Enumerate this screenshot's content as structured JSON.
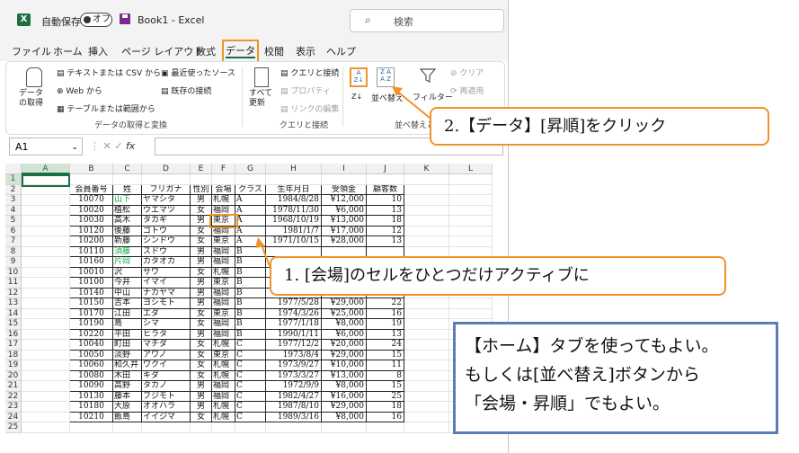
{
  "titlebar": {
    "logo_letter": "X",
    "autosave_label": "自動保存",
    "toggle_label": "オフ",
    "book_title": "Book1 - Excel",
    "search_placeholder": "検索",
    "search_icon": "search-icon"
  },
  "tabs": [
    {
      "label": "ファイル",
      "selected": false
    },
    {
      "label": "ホーム",
      "selected": false
    },
    {
      "label": "挿入",
      "selected": false
    },
    {
      "label": "ページ レイアウト",
      "selected": false
    },
    {
      "label": "数式",
      "selected": false
    },
    {
      "label": "データ",
      "selected": true
    },
    {
      "label": "校閲",
      "selected": false
    },
    {
      "label": "表示",
      "selected": false
    },
    {
      "label": "ヘルプ",
      "selected": false
    }
  ],
  "ribbon": {
    "get_data_label": "データの取得",
    "text_csv": "テキストまたは CSV から",
    "web": "Web から",
    "table_range": "テーブルまたは範囲から",
    "recent_sources": "最近使ったソース",
    "existing_conn": "既存の接続",
    "group1": "データの取得と変換",
    "refresh_all": "すべて更新",
    "queries_conn": "クエリと接続",
    "properties": "プロパティ",
    "edit_links": "リンクの編集",
    "group2": "クエリと接続",
    "sort_asc_icon": "sort-ascending-icon",
    "sort_desc_icon": "sort-descending-icon",
    "sort": "並べ替え",
    "filter": "フィルター",
    "clear": "クリア",
    "reapply": "再適用",
    "group3": "並べ替えと"
  },
  "formula_bar": {
    "name_box": "A1",
    "fx": "fx"
  },
  "grid": {
    "columns": [
      "A",
      "B",
      "C",
      "D",
      "E",
      "F",
      "G",
      "H",
      "I",
      "J",
      "K",
      "L"
    ],
    "headers": [
      "会員番号",
      "姓",
      "フリガナ",
      "性別",
      "会場",
      "クラス",
      "生年月日",
      "受領金",
      "顧客数"
    ],
    "rows": [
      [
        "10070",
        "山下",
        "ヤマシタ",
        "男",
        "札幌",
        "A",
        "1984/8/28",
        "¥12,000",
        "10"
      ],
      [
        "10020",
        "植松",
        "ウエマツ",
        "女",
        "福岡",
        "A",
        "1978/11/30",
        "¥6,000",
        "13"
      ],
      [
        "10030",
        "高木",
        "タカギ",
        "男",
        "東京",
        "A",
        "1968/10/19",
        "¥13,000",
        "18"
      ],
      [
        "10120",
        "後藤",
        "ゴトウ",
        "女",
        "福岡",
        "A",
        "1981/1/7",
        "¥17,000",
        "12"
      ],
      [
        "10200",
        "新藤",
        "シンドウ",
        "女",
        "東京",
        "A",
        "1971/10/15",
        "¥28,000",
        "13"
      ],
      [
        "10110",
        "須藤",
        "スドウ",
        "男",
        "福岡",
        "B",
        "",
        "",
        ""
      ],
      [
        "10160",
        "片岡",
        "カタオカ",
        "男",
        "福岡",
        "B",
        "",
        "",
        ""
      ],
      [
        "10010",
        "沢",
        "サワ",
        "女",
        "札幌",
        "B",
        "",
        "",
        ""
      ],
      [
        "10100",
        "今井",
        "イマイ",
        "男",
        "東京",
        "B",
        "",
        "",
        ""
      ],
      [
        "10140",
        "中山",
        "ナカヤマ",
        "男",
        "福岡",
        "B",
        "1990/4/20",
        "¥17,000",
        "11"
      ],
      [
        "10150",
        "吉本",
        "ヨシモト",
        "男",
        "福岡",
        "B",
        "1977/5/28",
        "¥29,000",
        "22"
      ],
      [
        "10170",
        "江田",
        "エダ",
        "女",
        "東京",
        "B",
        "1974/3/26",
        "¥25,000",
        "16"
      ],
      [
        "10190",
        "島",
        "シマ",
        "女",
        "福岡",
        "B",
        "1977/1/18",
        "¥8,000",
        "19"
      ],
      [
        "10220",
        "平田",
        "ヒラタ",
        "男",
        "福岡",
        "B",
        "1990/1/11",
        "¥6,000",
        "13"
      ],
      [
        "10040",
        "町田",
        "マチダ",
        "女",
        "札幌",
        "C",
        "1977/12/2",
        "¥20,000",
        "24"
      ],
      [
        "10050",
        "淡野",
        "アワノ",
        "女",
        "東京",
        "C",
        "1973/8/4",
        "¥29,000",
        "15"
      ],
      [
        "10060",
        "和久井",
        "ワクイ",
        "女",
        "札幌",
        "C",
        "1973/9/27",
        "¥10,000",
        "11"
      ],
      [
        "10080",
        "木田",
        "キダ",
        "女",
        "札幌",
        "C",
        "1973/3/27",
        "¥13,000",
        "8"
      ],
      [
        "10090",
        "高野",
        "タカノ",
        "男",
        "福岡",
        "C",
        "1972/9/9",
        "¥8,000",
        "15"
      ],
      [
        "10130",
        "藤本",
        "フジモト",
        "男",
        "福岡",
        "C",
        "1982/4/27",
        "¥16,000",
        "25"
      ],
      [
        "10180",
        "大原",
        "オオハラ",
        "男",
        "札幌",
        "C",
        "1987/8/10",
        "¥29,000",
        "18"
      ],
      [
        "10210",
        "飯島",
        "イイジマ",
        "女",
        "札幌",
        "C",
        "1989/3/16",
        "¥8,000",
        "16"
      ]
    ],
    "green_rows": [
      0,
      5,
      6
    ],
    "row_numbers": [
      "1",
      "2",
      "3",
      "4",
      "5",
      "6",
      "7",
      "8",
      "9",
      "10",
      "11",
      "12",
      "13",
      "14",
      "15",
      "16",
      "17",
      "18",
      "19",
      "20",
      "21",
      "22",
      "23",
      "24",
      "25"
    ]
  },
  "callouts": {
    "step2": "2.【データ】[昇順]をクリック",
    "step1": "1. [会場]のセルをひとつだけアクティブに",
    "note_line1": "【ホーム】タブを使ってもよい。",
    "note_line2": "もしくは[並べ替え]ボタンから",
    "note_line3": "「会場・昇順」でもよい。"
  },
  "colors": {
    "accent_orange": "#f0932b",
    "excel_green": "#1d6f42",
    "note_border": "#5b7db5",
    "name_green": "#1aa84a"
  }
}
